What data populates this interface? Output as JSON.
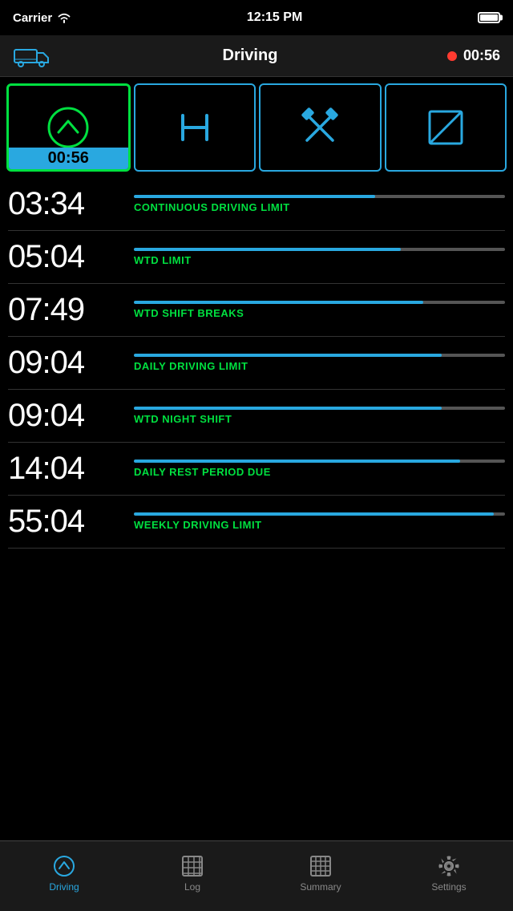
{
  "statusBar": {
    "carrier": "Carrier",
    "time": "12:15 PM"
  },
  "header": {
    "title": "Driving",
    "timer": "00:56"
  },
  "modeTabs": [
    {
      "id": "driving",
      "active": true,
      "time": "00:56"
    },
    {
      "id": "rest",
      "active": false,
      "time": ""
    },
    {
      "id": "work",
      "active": false,
      "time": ""
    },
    {
      "id": "available",
      "active": false,
      "time": ""
    }
  ],
  "limits": [
    {
      "time": "03:34",
      "label": "CONTINUOUS DRIVING LIMIT",
      "fillPercent": 65
    },
    {
      "time": "05:04",
      "label": "WTD LIMIT",
      "fillPercent": 72
    },
    {
      "time": "07:49",
      "label": "WTD SHIFT BREAKS",
      "fillPercent": 78
    },
    {
      "time": "09:04",
      "label": "DAILY DRIVING LIMIT",
      "fillPercent": 83
    },
    {
      "time": "09:04",
      "label": "WTD NIGHT SHIFT",
      "fillPercent": 83
    },
    {
      "time": "14:04",
      "label": "DAILY REST PERIOD DUE",
      "fillPercent": 88
    },
    {
      "time": "55:04",
      "label": "WEEKLY DRIVING LIMIT",
      "fillPercent": 97
    }
  ],
  "bottomNav": [
    {
      "id": "driving",
      "label": "Driving",
      "active": true
    },
    {
      "id": "log",
      "label": "Log",
      "active": false
    },
    {
      "id": "summary",
      "label": "Summary",
      "active": false
    },
    {
      "id": "settings",
      "label": "Settings",
      "active": false
    }
  ]
}
